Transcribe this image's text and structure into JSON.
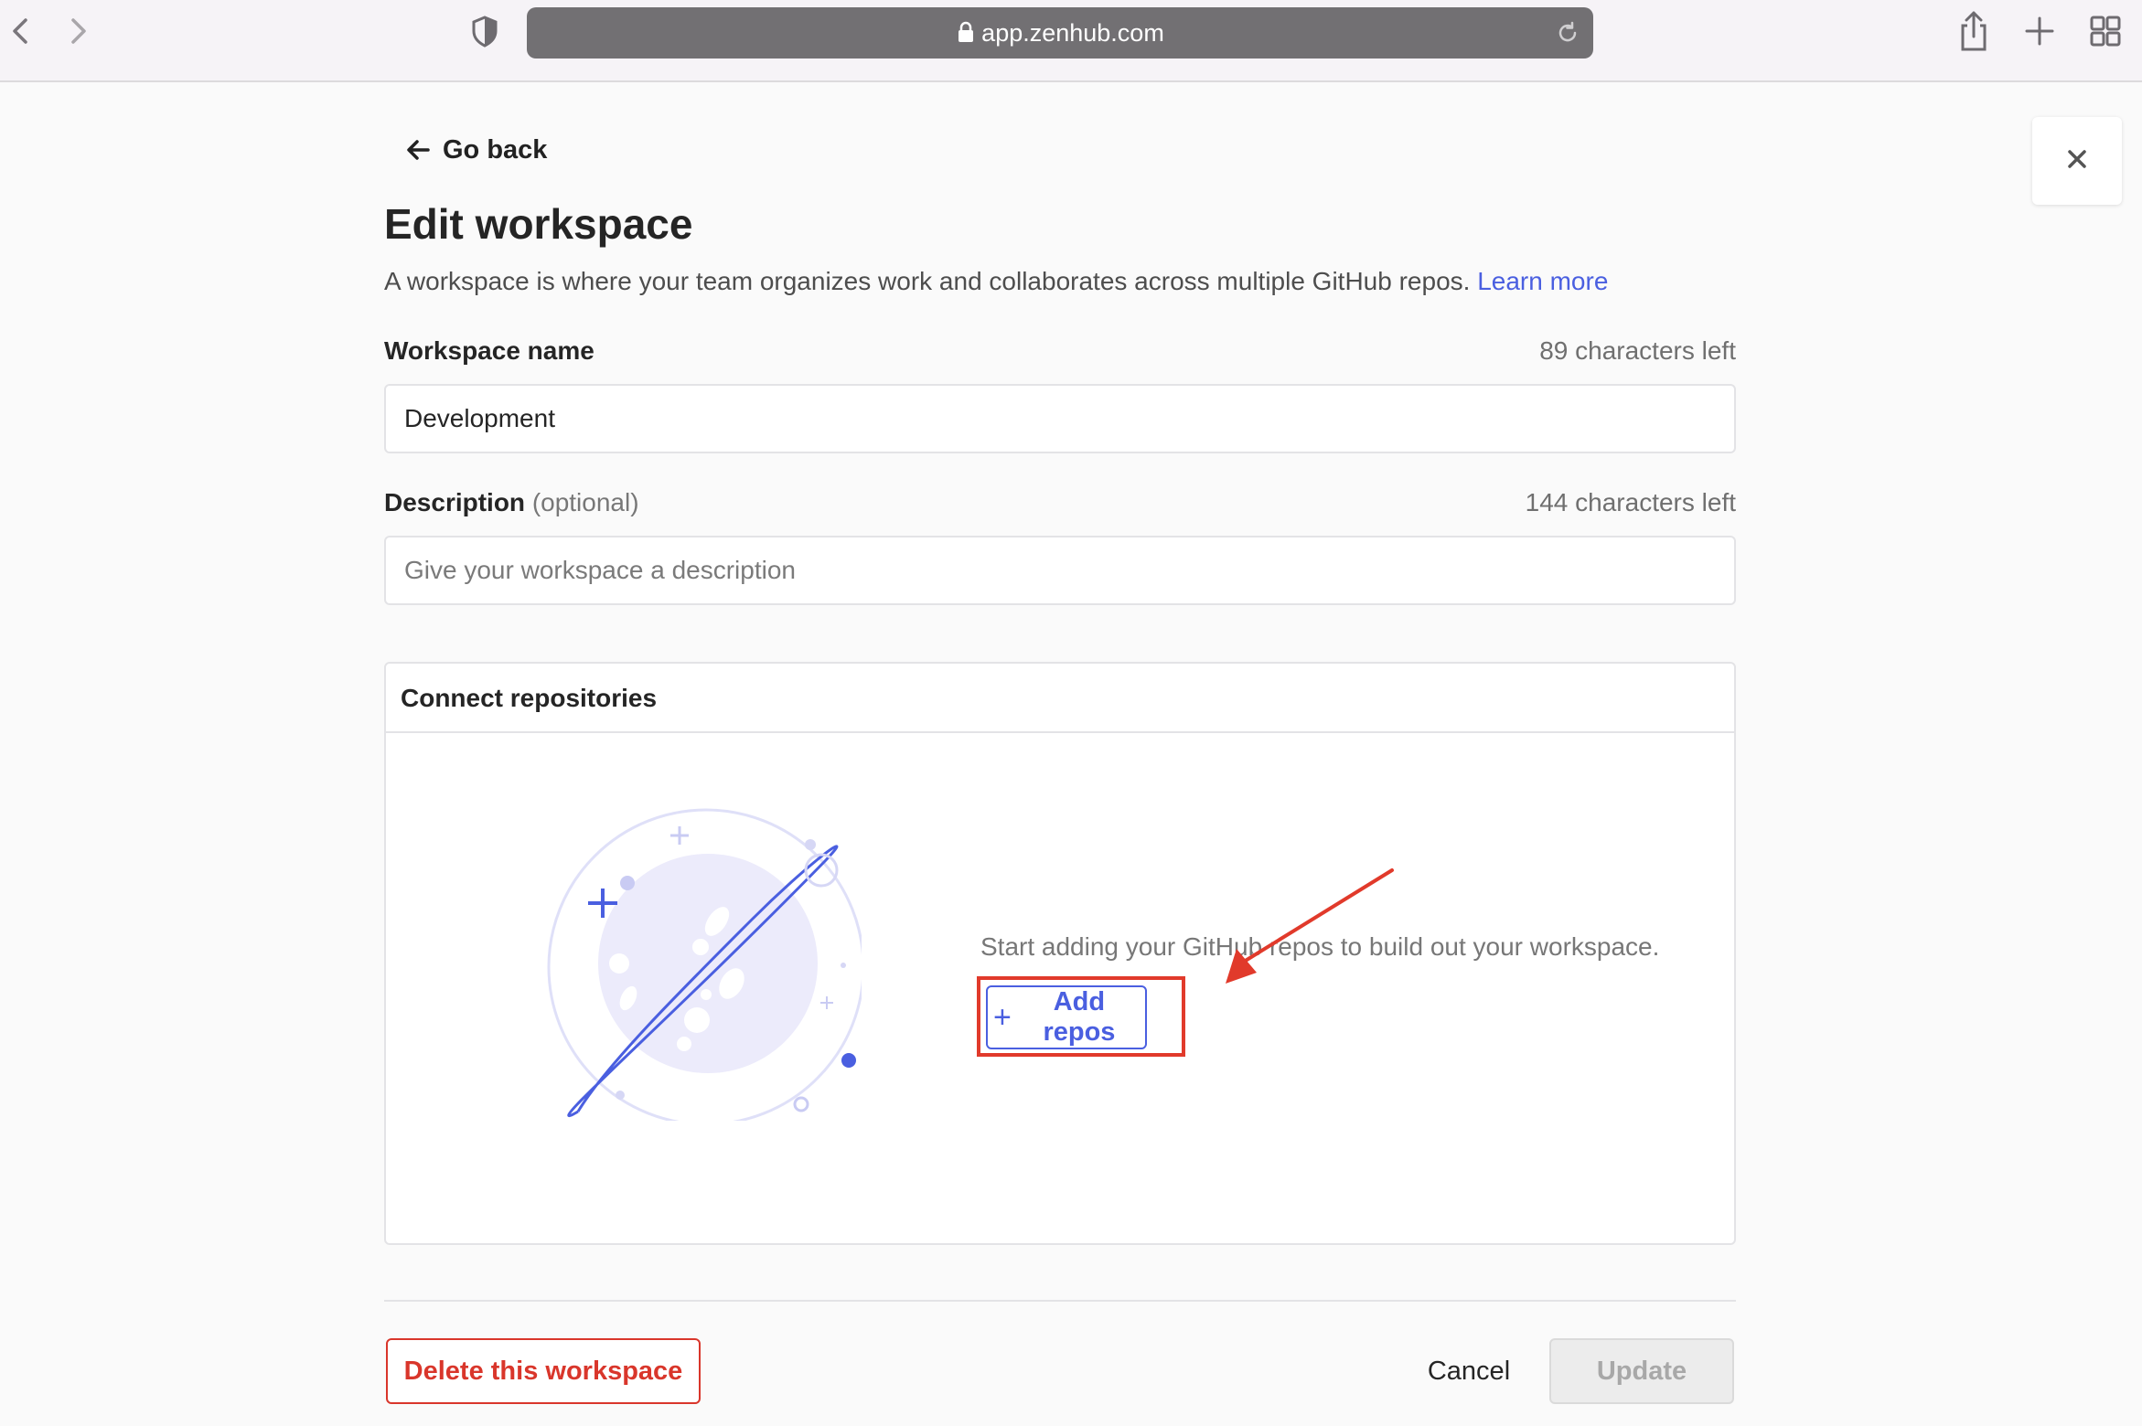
{
  "browser": {
    "url": "app.zenhub.com",
    "icons": [
      "back-icon",
      "forward-icon",
      "shield-icon",
      "lock-icon",
      "reload-icon",
      "share-icon",
      "new-tab-icon",
      "tabs-overview-icon"
    ]
  },
  "page": {
    "go_back": "Go back",
    "title": "Edit workspace",
    "subtitle": "A workspace is where your team organizes work and collaborates across multiple GitHub repos.",
    "learn_more": "Learn more"
  },
  "workspace_name": {
    "label": "Workspace name",
    "counter": "89 characters left",
    "value": "Development"
  },
  "description": {
    "label": "Description",
    "optional": "(optional)",
    "counter": "144 characters left",
    "placeholder": "Give your workspace a description",
    "value": ""
  },
  "repositories": {
    "header": "Connect repositories",
    "empty_text": "Start adding your GitHub repos to build out your workspace.",
    "add_button": "Add repos",
    "add_icon": "plus-icon"
  },
  "footer": {
    "delete": "Delete this workspace",
    "cancel": "Cancel",
    "update": "Update"
  },
  "colors": {
    "accent": "#4a5fe0",
    "danger": "#d9362b",
    "annotation": "#e13a2b"
  }
}
